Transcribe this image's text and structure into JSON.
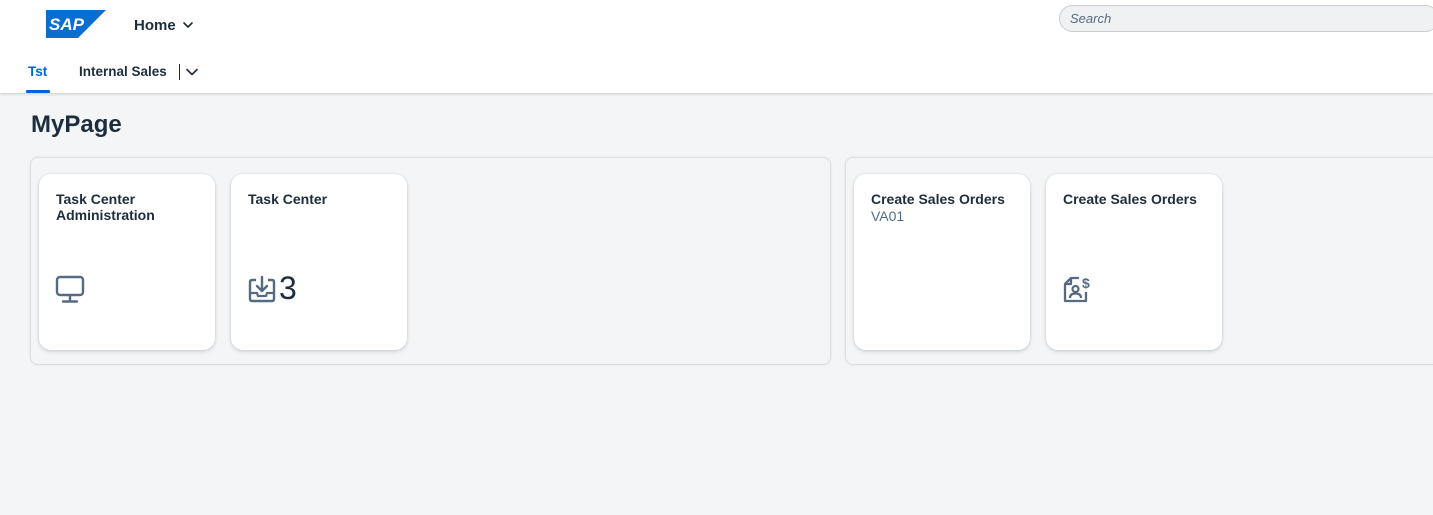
{
  "colors": {
    "brand": "#0a6ed1",
    "accent": "#0064d9",
    "icon": "#556b82",
    "background": "#f4f5f6"
  },
  "shell": {
    "logo_text": "SAP",
    "home_menu": {
      "label": "Home",
      "icon": "chevron-down-icon"
    },
    "search": {
      "placeholder": "Search",
      "value": ""
    }
  },
  "tabs": [
    {
      "label": "Tst",
      "active": true
    },
    {
      "label": "Internal Sales",
      "active": false
    }
  ],
  "tabs_overflow_icon": "chevron-down-icon",
  "page": {
    "title": "MyPage"
  },
  "sections": [
    {
      "tiles": [
        {
          "title": "Task Center Administration",
          "subtitle": "",
          "icon": "monitor-icon",
          "count": ""
        },
        {
          "title": "Task Center",
          "subtitle": "",
          "icon": "inbox-download-icon",
          "count": "3"
        }
      ]
    },
    {
      "tiles": [
        {
          "title": "Create Sales Orders",
          "subtitle": "VA01",
          "icon": "",
          "count": ""
        },
        {
          "title": "Create Sales Orders",
          "subtitle": "",
          "icon": "sales-document-icon",
          "count": ""
        }
      ]
    }
  ]
}
